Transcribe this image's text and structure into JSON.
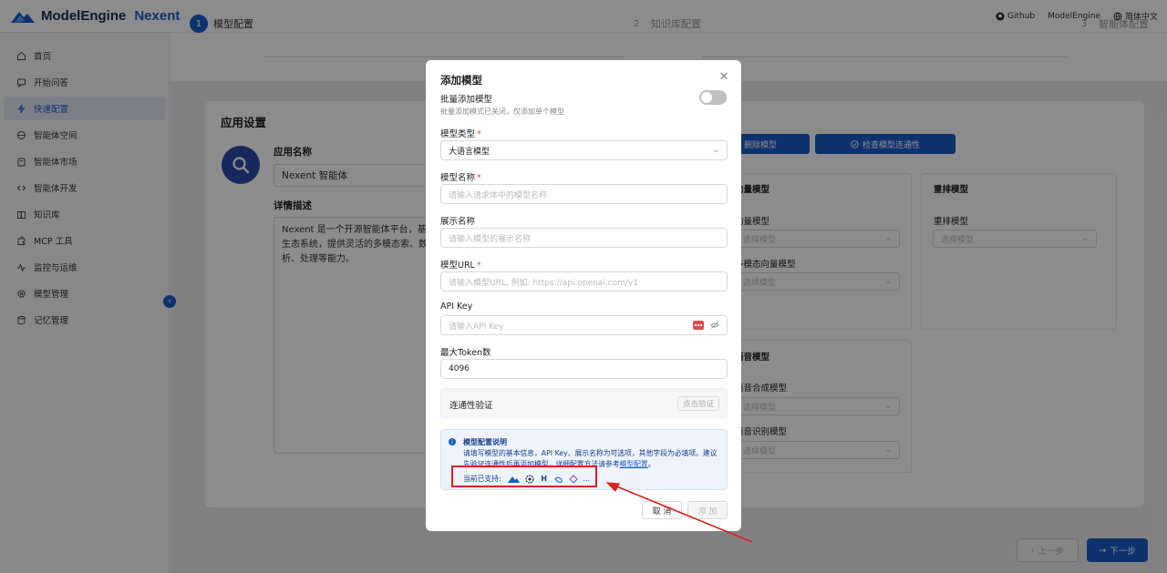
{
  "header": {
    "logo_text": "ModelEngine",
    "product_text": "Nexent",
    "github_label": "Github",
    "modelengine_label": "ModelEngine",
    "language_label": "简体中文"
  },
  "sidebar": {
    "items": [
      {
        "label": "首页",
        "icon": "home-icon"
      },
      {
        "label": "开始问答",
        "icon": "chat-icon"
      },
      {
        "label": "快速配置",
        "icon": "bolt-icon",
        "active": true
      },
      {
        "label": "智能体空间",
        "icon": "globe-icon"
      },
      {
        "label": "智能体市场",
        "icon": "store-icon"
      },
      {
        "label": "智能体开发",
        "icon": "code-icon"
      },
      {
        "label": "知识库",
        "icon": "book-icon"
      },
      {
        "label": "MCP 工具",
        "icon": "puzzle-icon"
      },
      {
        "label": "监控与运维",
        "icon": "pulse-icon"
      },
      {
        "label": "模型管理",
        "icon": "gear-icon"
      },
      {
        "label": "记忆管理",
        "icon": "database-icon"
      }
    ],
    "collapse_glyph": "‹"
  },
  "steps": [
    {
      "num": "1",
      "label": "模型配置",
      "active": true
    },
    {
      "num": "2",
      "label": "知识库配置"
    },
    {
      "num": "3",
      "label": "智能体配置"
    }
  ],
  "app_settings": {
    "title": "应用设置",
    "name_label": "应用名称",
    "name_value": "Nexent 智能体",
    "desc_label": "详情描述",
    "desc_value": "Nexent 是一个开源智能体平台，基工具生态系统，提供灵活的多模态索、数据分析、处理等能力。"
  },
  "model_panel": {
    "delete_button": "删除模型",
    "check_button": "检查模型连通性",
    "vector_section": "向量模型",
    "vector_label": "向量模型",
    "multimodal_vector_label": "多模态向量模型",
    "rerank_section": "重排模型",
    "rerank_label": "重排模型",
    "voice_section": "语音模型",
    "tts_label": "语音合成模型",
    "asr_label": "语音识别模型",
    "select_placeholder": "选择模型"
  },
  "bottom_nav": {
    "prev_label": "上一步",
    "next_label": "下一步"
  },
  "modal": {
    "title": "添加模型",
    "batch_label": "批量添加模型",
    "batch_hint": "批量添加模式已关闭，仅添加单个模型",
    "batch_enabled": false,
    "type_label": "模型类型",
    "type_value": "大语言模型",
    "name_label": "模型名称",
    "name_placeholder": "请输入请求体中的模型名称",
    "display_label": "展示名称",
    "display_placeholder": "请输入模型的展示名称",
    "url_label": "模型URL",
    "url_placeholder": "请输入模型URL, 例如: https://api.openai.com/v1",
    "apikey_label": "API Key",
    "apikey_placeholder": "请输入API Key",
    "maxtoken_label": "最大Token数",
    "maxtoken_value": "4096",
    "verify_label": "连通性验证",
    "verify_button": "点击验证",
    "info_title": "模型配置说明",
    "info_text": "请填写模型的基本信息，API Key、展示名称为可选项，其他字段为必填项。建议先验证连通性后再添加模型，详细配置方法请参考",
    "info_link": "模型配置",
    "info_end": "。",
    "supports_label": "当前已支持:",
    "supports_more": "...",
    "cancel_label": "取 消",
    "add_label": "添 加"
  },
  "colors": {
    "primary": "#1a5cc8",
    "required": "#e34d4d",
    "highlight": "#e02020"
  }
}
